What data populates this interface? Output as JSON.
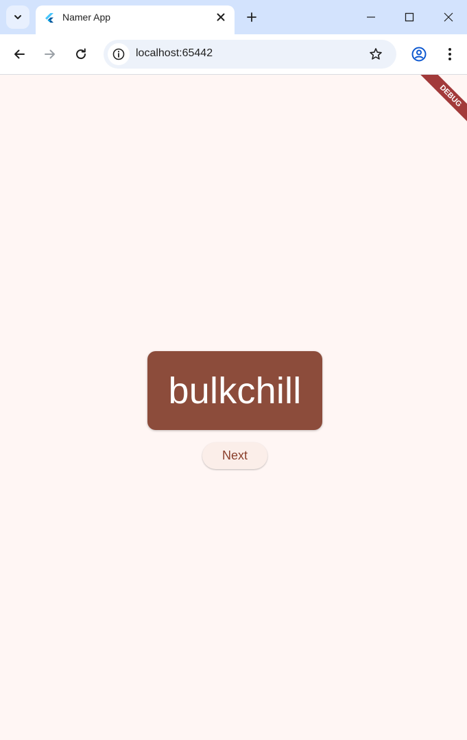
{
  "browser": {
    "tab": {
      "title": "Namer App",
      "favicon": "flutter-icon"
    },
    "address": {
      "url": "localhost:65442"
    },
    "icons": {
      "tab_search": "chevron-down-icon",
      "close_tab": "close-icon",
      "new_tab": "plus-icon",
      "minimize": "minimize-icon",
      "maximize": "maximize-icon",
      "close_window": "close-icon",
      "back": "back-arrow-icon",
      "forward": "forward-arrow-icon",
      "reload": "reload-icon",
      "site_info": "info-icon",
      "bookmark": "star-icon",
      "profile": "profile-icon",
      "menu": "more-vert-icon"
    },
    "colors": {
      "titlebar": "#d3e3fd",
      "omnibox": "#edf2fa",
      "profile_accent": "#0b57d0"
    }
  },
  "app": {
    "debug_banner": "DEBUG",
    "word": "bulkchill",
    "next_label": "Next",
    "colors": {
      "background": "#fff6f4",
      "card": "#8c4c3b",
      "card_text": "#ffffff",
      "button_bg": "#fbeee9",
      "button_text": "#8a3f2b",
      "debug_ribbon": "#a23a3a"
    }
  }
}
